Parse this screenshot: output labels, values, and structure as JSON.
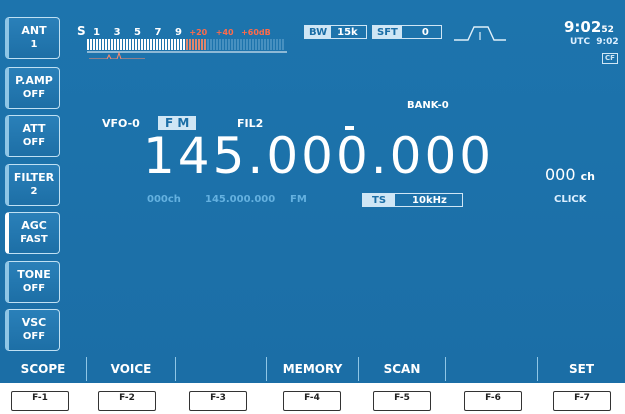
{
  "left_keys": [
    {
      "label": "ANT",
      "value": "1"
    },
    {
      "label": "P.AMP",
      "value": "OFF"
    },
    {
      "label": "ATT",
      "value": "OFF"
    },
    {
      "label": "FILTER",
      "value": "2"
    },
    {
      "label": "AGC",
      "value": "FAST"
    },
    {
      "label": "TONE",
      "value": "OFF"
    },
    {
      "label": "VSC",
      "value": "OFF"
    }
  ],
  "smeter": {
    "s_label": "S",
    "scale_white": [
      "1",
      "3",
      "5",
      "7",
      "9"
    ],
    "scale_red": [
      "+20",
      "+40",
      "+60dB"
    ],
    "level_fraction": 0.6
  },
  "bw": {
    "tag": "BW",
    "value": "15k"
  },
  "sft": {
    "tag": "SFT",
    "value": "0"
  },
  "clock": {
    "time": "9:02",
    "seconds": "52",
    "utc_label": "UTC",
    "utc_time": "9:02",
    "badge": "CF"
  },
  "bank": "BANK-0",
  "vfo": {
    "label": "VFO-0",
    "mode": "F M",
    "filter": "FIL2"
  },
  "frequency": "145.000.000",
  "channel": {
    "value": "000",
    "unit": "ch"
  },
  "sub_info": {
    "channel": "000ch",
    "freq": "145.000.000",
    "mode": "FM"
  },
  "ts": {
    "tag": "TS",
    "value": "10kHz"
  },
  "click_label": "CLICK",
  "soft_keys": [
    "SCOPE",
    "VOICE",
    "",
    "MEMORY",
    "SCAN",
    "",
    "SET"
  ],
  "f_buttons": [
    "F-1",
    "F-2",
    "F-3",
    "F-4",
    "F-5",
    "F-6",
    "F-7"
  ],
  "colors": {
    "screen": "#1b6ea6",
    "accent": "#ffffff",
    "sub_text": "#64b1e0",
    "meter_red": "#ff6b4a"
  }
}
